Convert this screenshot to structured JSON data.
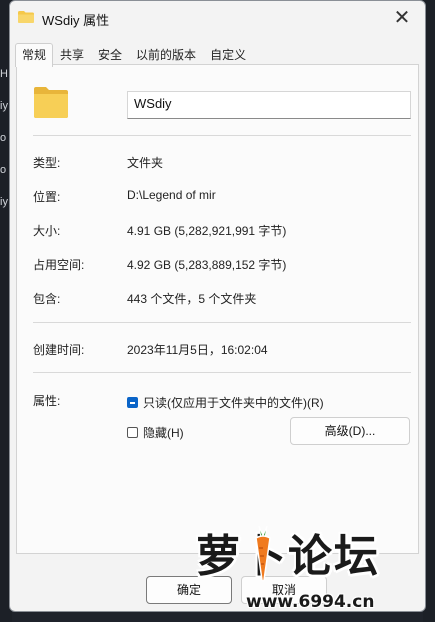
{
  "background_fragments": [
    "H",
    "iy",
    "o",
    "o",
    "iy"
  ],
  "window": {
    "title": "WSdiy 属性",
    "close_glyph": "✕"
  },
  "tabs": [
    {
      "label": "常规",
      "active": true
    },
    {
      "label": "共享",
      "active": false
    },
    {
      "label": "安全",
      "active": false
    },
    {
      "label": "以前的版本",
      "active": false
    },
    {
      "label": "自定义",
      "active": false
    }
  ],
  "general": {
    "folder_name": "WSdiy",
    "type_label": "类型:",
    "type_value": "文件夹",
    "location_label": "位置:",
    "location_value": "D:\\Legend of mir",
    "size_label": "大小:",
    "size_value": "4.91 GB (5,282,921,991 字节)",
    "disk_size_label": "占用空间:",
    "disk_size_value": "4.92 GB (5,283,889,152 字节)",
    "contains_label": "包含:",
    "contains_value": "443 个文件，5 个文件夹",
    "created_label": "创建时间:",
    "created_value": "2023年11月5日，16:02:04",
    "attributes_label": "属性:",
    "readonly_label": "只读(仅应用于文件夹中的文件)(R)",
    "readonly_state": "indeterminate",
    "hidden_label": "隐藏(H)",
    "hidden_state": "unchecked",
    "advanced_button": "高级(D)..."
  },
  "footer": {
    "ok_label": "确定",
    "cancel_label": "取消"
  },
  "watermark": {
    "text": "萝卜论坛",
    "url": "www.6994.cn"
  },
  "colors": {
    "accent": "#0a64c8",
    "folder_yellow": "#f5c84a",
    "dialog_bg": "#f3f3f3"
  }
}
